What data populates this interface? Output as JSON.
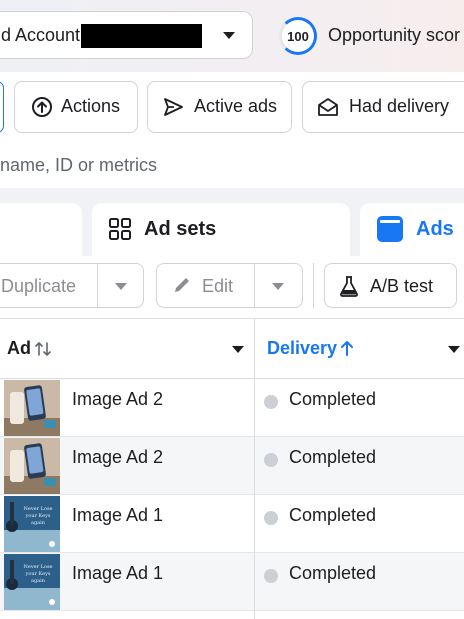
{
  "header": {
    "account_label": "d Account",
    "opportunity_score": "100",
    "opportunity_label": "Opportunity scor"
  },
  "filters": {
    "actions_label": "Actions",
    "active_ads_label": "Active ads",
    "had_delivery_label": "Had delivery"
  },
  "search": {
    "placeholder": "name, ID or metrics"
  },
  "tabs": {
    "ad_sets_label": "Ad sets",
    "ads_label": "Ads"
  },
  "toolbar": {
    "duplicate_label": "Duplicate",
    "edit_label": "Edit",
    "ab_test_label": "A/B test"
  },
  "table": {
    "columns": {
      "ad_label": "Ad",
      "delivery_label": "Delivery"
    },
    "rows": [
      {
        "name": "Image Ad 2",
        "status": "Completed",
        "thumbnail": "phone-on-table"
      },
      {
        "name": "Image Ad 2",
        "status": "Completed",
        "thumbnail": "phone-on-table"
      },
      {
        "name": "Image Ad 1",
        "status": "Completed",
        "thumbnail": "blue-poster"
      },
      {
        "name": "Image Ad 1",
        "status": "Completed",
        "thumbnail": "blue-poster"
      }
    ],
    "thumbnail_text": "Never Lose your Keys again"
  },
  "colors": {
    "accent": "#1877f2",
    "status_completed": "#ccd0d5"
  }
}
